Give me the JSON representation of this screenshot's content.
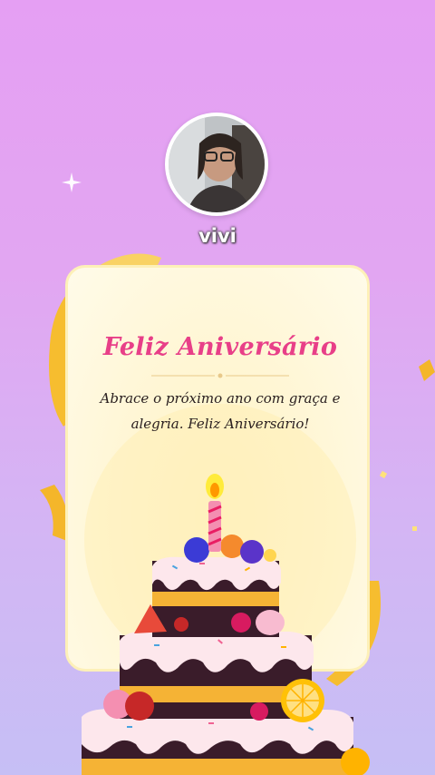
{
  "profile": {
    "username": "vivi"
  },
  "card": {
    "title": "Feliz Aniversário",
    "message": "Abrace o próximo ano com graça e alegria. Feliz Aniversário!"
  },
  "colors": {
    "background_top": "#e59ff3",
    "background_bottom": "#c6bff5",
    "title": "#e83f88",
    "card": "#fff6d4",
    "ribbon": "#f6bd2f"
  },
  "icons": [
    "sparkle-icon",
    "ribbon-decoration",
    "birthday-cake-illustration"
  ]
}
